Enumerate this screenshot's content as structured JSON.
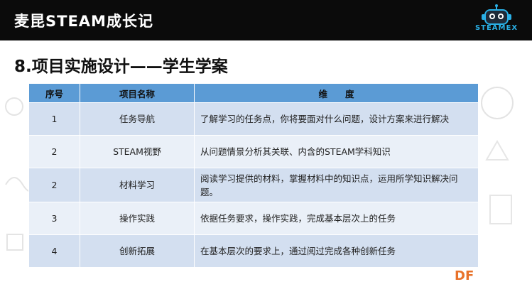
{
  "header": {
    "title": "麦昆STEAM成长记",
    "logo_text": "STEAMEX"
  },
  "page_title": "8.项目实施设计——学生学案",
  "table": {
    "headers": [
      "序号",
      "项目名称",
      "维　　度"
    ],
    "rows": [
      {
        "num": "1",
        "name": "任务导航",
        "desc": "了解学习的任务点，你将要面对什么问题，设计方案来进行解决"
      },
      {
        "num": "2",
        "name": "STEAM视野",
        "desc": "从问题情景分析其关联、内含的STEAM学科知识"
      },
      {
        "num": "2",
        "name": "材料学习",
        "desc": "阅读学习提供的材料，掌握材料中的知识点，运用所学知识解决问题。"
      },
      {
        "num": "3",
        "name": "操作实践",
        "desc": "依据任务要求，操作实践，完成基本层次上的任务"
      },
      {
        "num": "4",
        "name": "创新拓展",
        "desc": "在基本层次的要求上，通过阅过完成各种创新任务"
      }
    ]
  },
  "watermark": "DF",
  "colors": {
    "header_bg": "#0b0b0b",
    "table_header": "#5b9bd5",
    "row_odd": "#d3dff0",
    "row_even": "#eaf0f8",
    "logo_accent": "#2ab0e6",
    "df_orange": "#e8722a"
  }
}
